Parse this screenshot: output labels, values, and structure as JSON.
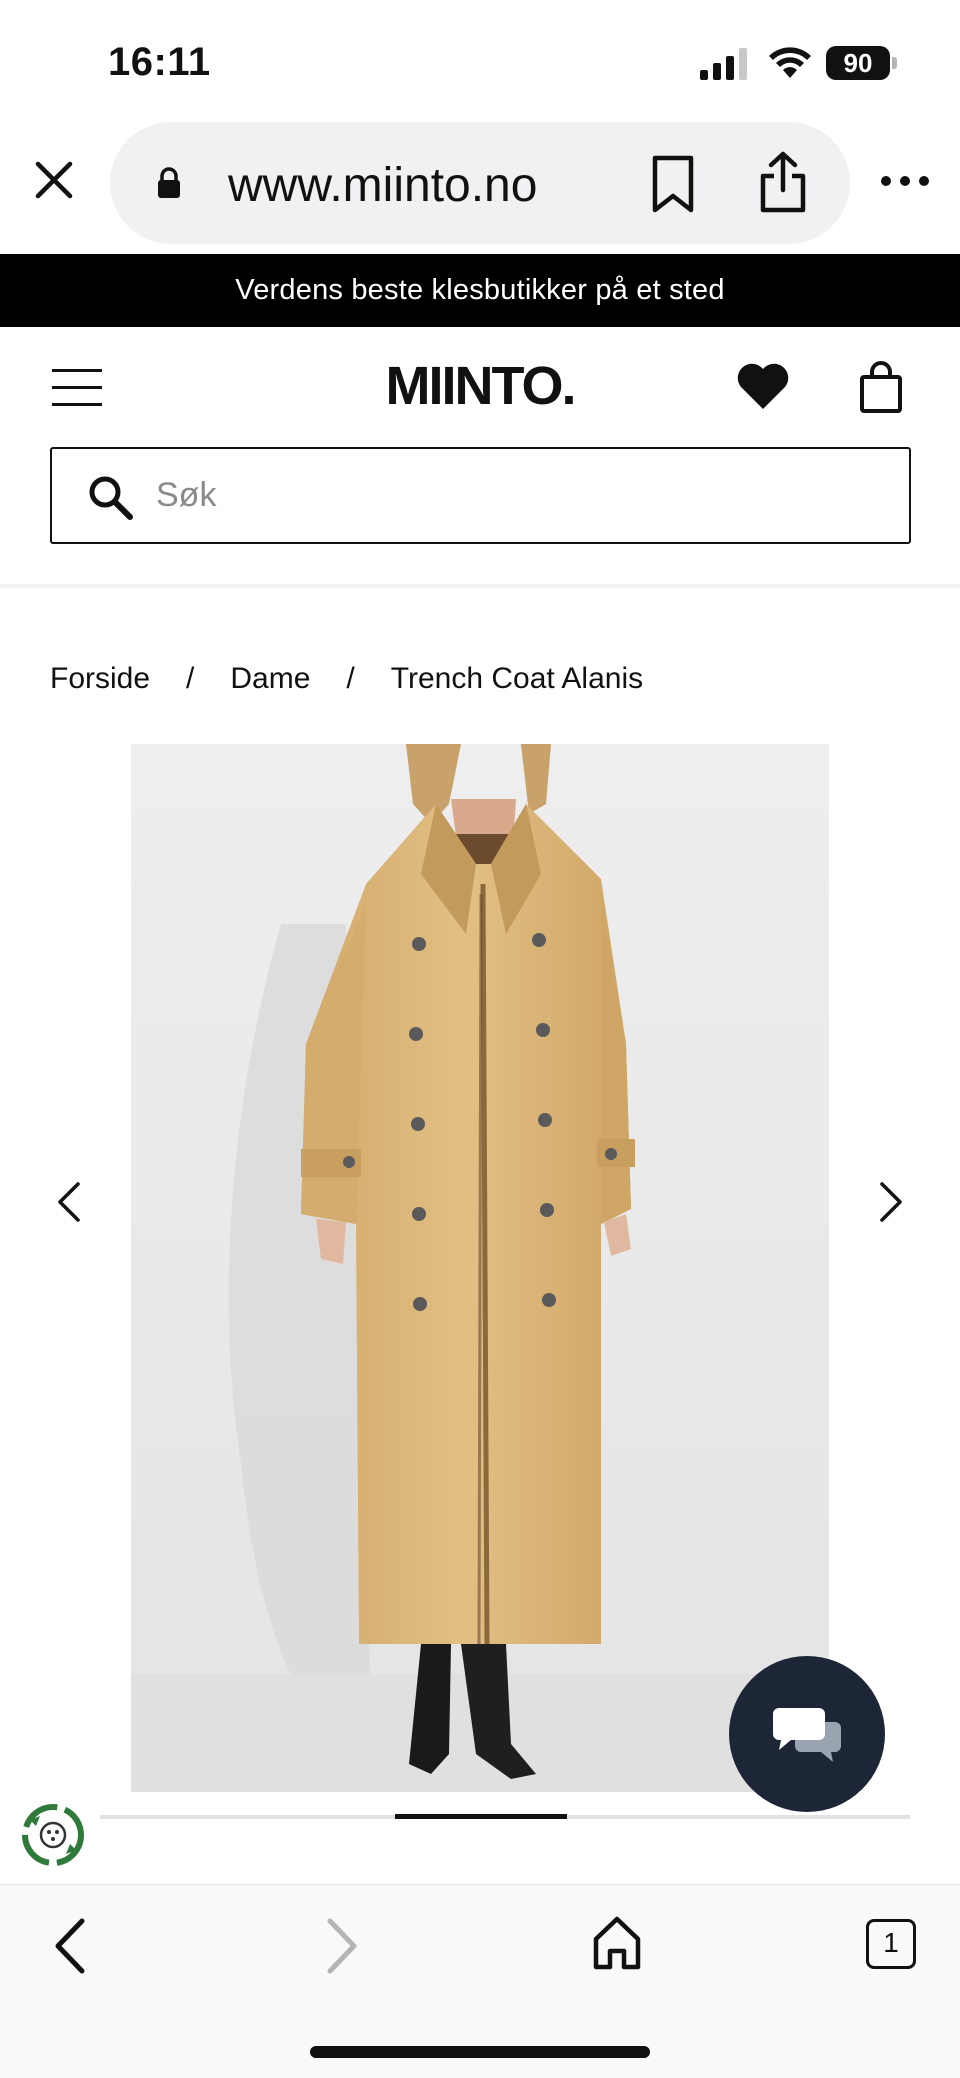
{
  "status_bar": {
    "time": "16:11",
    "battery": "90",
    "signal_icon": "cellular-signal-icon",
    "wifi_icon": "wifi-icon"
  },
  "browser": {
    "url": "www.miinto.no",
    "close_icon": "close-icon",
    "lock_icon": "lock-icon",
    "bookmark_icon": "bookmark-icon",
    "share_icon": "share-icon",
    "more_icon": "more-icon"
  },
  "promo": {
    "text": "Verdens beste klesbutikker på et sted"
  },
  "header": {
    "logo": "MIINTO.",
    "menu_icon": "hamburger-menu-icon",
    "wishlist_icon": "heart-icon",
    "cart_icon": "shopping-bag-icon"
  },
  "search": {
    "placeholder": "Søk",
    "value": ""
  },
  "breadcrumb": {
    "items": [
      "Forside",
      "Dame",
      "Trench Coat Alanis"
    ],
    "separator": "/"
  },
  "product": {
    "image_alt": "Trench Coat Alanis",
    "carousel_position": 0.42
  },
  "bottom_nav": {
    "tabs_count": "1",
    "back_icon": "chevron-left-icon",
    "forward_icon": "chevron-right-icon",
    "home_icon": "home-icon",
    "tabs_icon": "tabs-icon"
  },
  "colors": {
    "banner_bg": "#000000",
    "chat_bg": "#1d2637",
    "coat": "#ddb87c",
    "recycle": "#2f7a3a"
  }
}
